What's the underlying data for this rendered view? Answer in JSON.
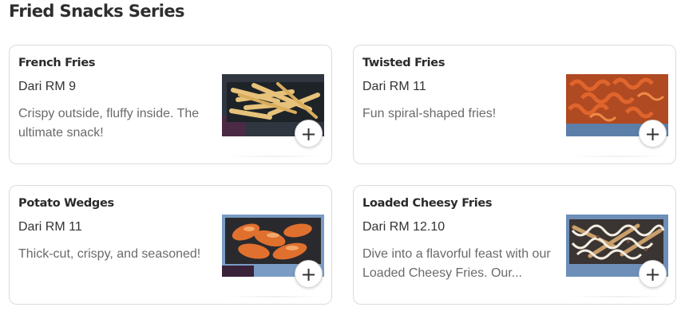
{
  "section": {
    "title": "Fried Snacks Series"
  },
  "items": [
    {
      "name": "French Fries",
      "price": "Dari RM 9",
      "description": "Crispy outside, fluffy inside. The ultimate snack!",
      "image": "french-fries-photo"
    },
    {
      "name": "Twisted Fries",
      "price": "Dari RM 11",
      "description": "Fun spiral-shaped fries!",
      "image": "twisted-fries-photo"
    },
    {
      "name": "Potato Wedges",
      "price": "Dari RM 11",
      "description": "Thick-cut, crispy, and seasoned!",
      "image": "potato-wedges-photo"
    },
    {
      "name": "Loaded Cheesy Fries",
      "price": "Dari RM 12.10",
      "description": "Dive into a flavorful feast with our Loaded Cheesy Fries. Our...",
      "image": "loaded-cheesy-fries-photo"
    }
  ],
  "add_button": {
    "icon": "plus-icon",
    "glyph": "+"
  }
}
